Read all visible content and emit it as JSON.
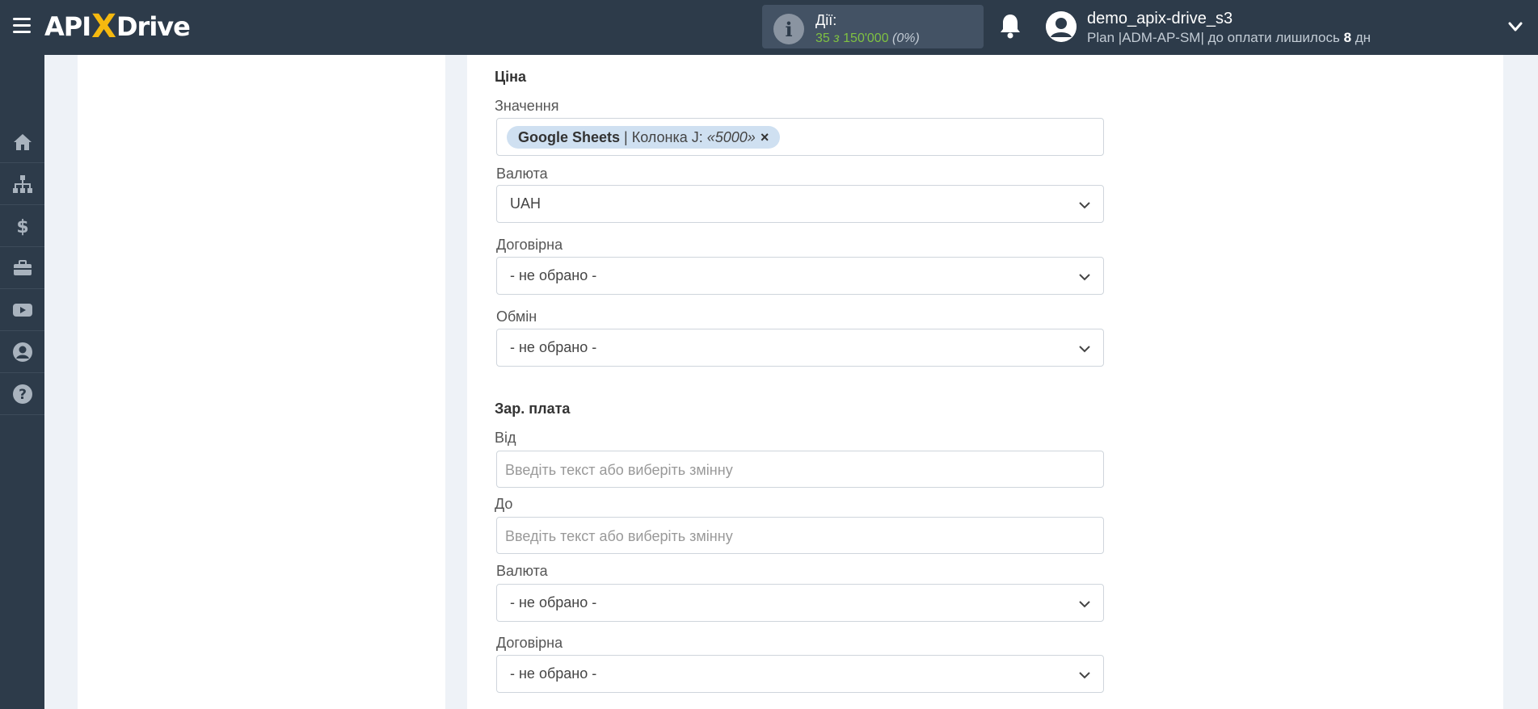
{
  "header": {
    "logo_left": "API",
    "logo_x": "X",
    "logo_right": "Drive",
    "actions": {
      "label": "Дії:",
      "used": "35",
      "sep": "з",
      "total": "150'000",
      "percent": "(0%)"
    },
    "user": {
      "name": "demo_apix-drive_s3",
      "plan_prefix": "Plan |ADM-AP-SM| до оплати лишилось",
      "days": "8",
      "days_unit": "дн"
    }
  },
  "sidebar": {
    "items": [
      "home-icon",
      "sitemap-icon",
      "dollar-icon",
      "briefcase-icon",
      "youtube-icon",
      "user-icon",
      "help-icon"
    ]
  },
  "form": {
    "price_section": {
      "title": "Ціна",
      "value_label": "Значення",
      "value_tag": {
        "source": "Google Sheets",
        "column": "| Колонка J:",
        "sample": "«5000»",
        "remove": "×"
      },
      "currency_label": "Валюта",
      "currency_value": "UAH",
      "negotiable_label": "Договірна",
      "negotiable_value": "- не обрано -",
      "exchange_label": "Обмін",
      "exchange_value": "- не обрано -"
    },
    "salary_section": {
      "title": "Зар. плата",
      "from_label": "Від",
      "from_placeholder": "Введіть текст або виберіть змінну",
      "to_label": "До",
      "to_placeholder": "Введіть текст або виберіть змінну",
      "currency_label": "Валюта",
      "currency_value": "- не обрано -",
      "negotiable_label": "Договірна",
      "negotiable_value": "- не обрано -"
    }
  },
  "colors": {
    "topbar": "#2d3b4a",
    "accent_green": "#7fc142",
    "logo_x": "#f5b90f",
    "tag_bg": "#cfe0f1"
  }
}
